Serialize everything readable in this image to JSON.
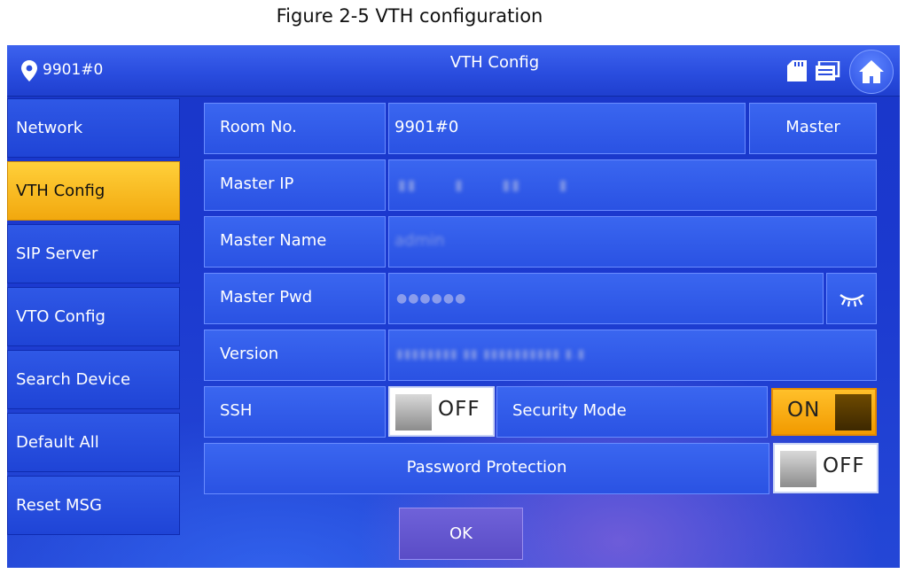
{
  "caption": "Figure 2-5 VTH configuration",
  "topbar": {
    "location": "9901#0",
    "title": "VTH Config",
    "icons": [
      "location-pin-icon",
      "sd-card-icon",
      "message-icon",
      "home-icon"
    ]
  },
  "sidebar": {
    "items": [
      {
        "label": "Network"
      },
      {
        "label": "VTH Config",
        "active": true
      },
      {
        "label": "SIP Server"
      },
      {
        "label": "VTO Config"
      },
      {
        "label": "Search Device"
      },
      {
        "label": "Default All"
      },
      {
        "label": "Reset MSG"
      }
    ]
  },
  "form": {
    "room_no": {
      "label": "Room No.",
      "value": "9901#0",
      "button": "Master"
    },
    "master_ip": {
      "label": "Master IP"
    },
    "master_name": {
      "label": "Master Name",
      "value": "admin"
    },
    "master_pwd": {
      "label": "Master Pwd",
      "value": "●●●●●●"
    },
    "version": {
      "label": "Version"
    },
    "ssh": {
      "label": "SSH",
      "state": "OFF"
    },
    "security_mode": {
      "label": "Security Mode",
      "state": "ON"
    },
    "password_protection": {
      "label": "Password Protection",
      "state": "OFF"
    }
  },
  "ok_label": "OK",
  "colors": {
    "accent_active": "#f5b014",
    "panel_blue": "#2a52e3",
    "toggle_on": "#f29a00"
  }
}
